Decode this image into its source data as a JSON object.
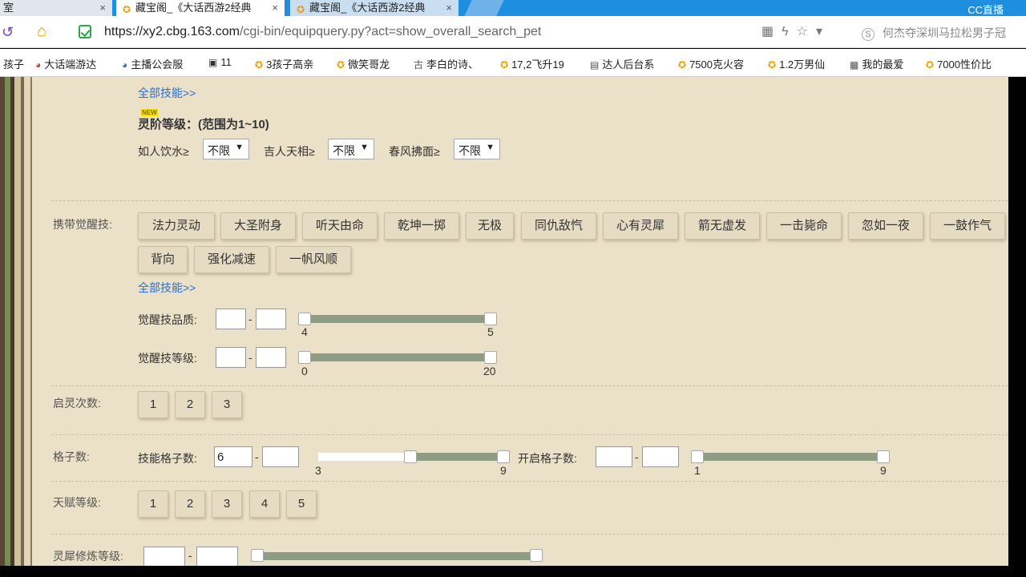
{
  "browser": {
    "tabs": [
      {
        "label": "室",
        "close": "×"
      },
      {
        "label": "藏宝阁_《大话西游2经典",
        "close": "×"
      },
      {
        "label": "藏宝阁_《大话西游2经典",
        "close": "×"
      }
    ],
    "brand": "CC直播",
    "url_host": "https://xy2.cbg.163.com",
    "url_path": "/cgi-bin/equipquery.py?act=show_overall_search_pet",
    "search_text": "何杰夺深圳马拉松男子冠",
    "bookmarks": [
      "孩子",
      "大话端游达",
      "主播公会服",
      "11",
      "3孩子高亲",
      "微笑哥龙",
      "李白的诗、",
      "17,2飞升19",
      "达人后台系",
      "7500克火容",
      "1.2万男仙",
      "我的最爱",
      "7000性价比"
    ]
  },
  "top_section": {
    "all_skills_link": "全部技能>>",
    "new_badge": "NEW",
    "spirit_level_title": "灵阶等级：(范围为1~10)",
    "filters": [
      {
        "label": "如人饮水≥",
        "value": "不限"
      },
      {
        "label": "吉人天相≥",
        "value": "不限"
      },
      {
        "label": "春风拂面≥",
        "value": "不限"
      }
    ],
    "dropdown_arrow": "▼"
  },
  "awaken": {
    "label": "携带觉醒技:",
    "skills_row1": [
      "法力灵动",
      "大圣附身",
      "听天由命",
      "乾坤一掷",
      "无极",
      "同仇敌忾",
      "心有灵犀",
      "箭无虚发",
      "一击毙命",
      "忽如一夜",
      "一鼓作气"
    ],
    "skills_row2": [
      "背向",
      "强化减速",
      "一帆风顺"
    ],
    "all_skills_link": "全部技能>>",
    "quality_label": "觉醒技品质:",
    "quality_min": "4",
    "quality_max": "5",
    "level_label": "觉醒技等级:",
    "level_min": "0",
    "level_max": "20",
    "dash": "-"
  },
  "enlighten": {
    "label": "启灵次数:",
    "options": [
      "1",
      "2",
      "3"
    ]
  },
  "slots": {
    "label": "格子数:",
    "skill_slots_label": "技能格子数:",
    "skill_slots_value": "6",
    "skill_min": "3",
    "skill_max": "9",
    "open_slots_label": "开启格子数:",
    "open_min": "1",
    "open_max": "9",
    "dash": "-"
  },
  "talent": {
    "label": "天赋等级:",
    "options": [
      "1",
      "2",
      "3",
      "4",
      "5"
    ]
  },
  "lingxi": {
    "label": "灵犀修炼等级:",
    "dash": "-"
  }
}
